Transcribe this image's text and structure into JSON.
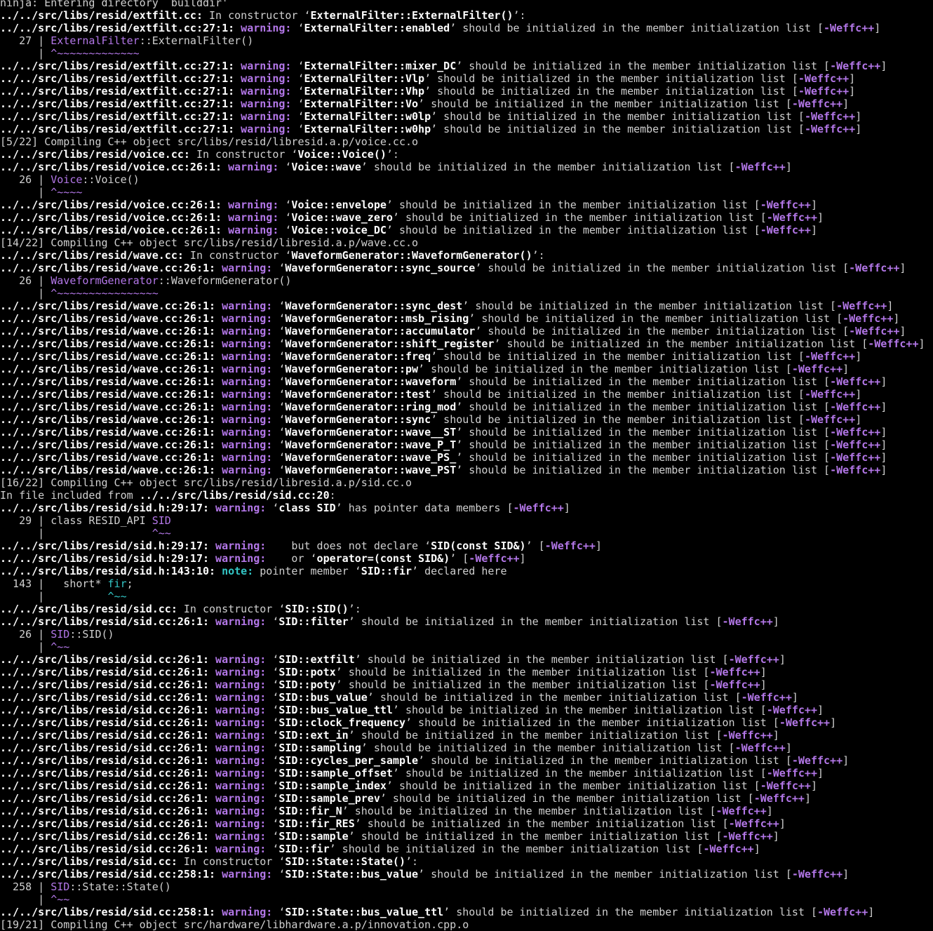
{
  "terminal": {
    "lines": [
      {
        "t": "raw",
        "text": "ninja: Entering directory `builddir'"
      },
      {
        "t": "loc",
        "loc": "../../src/libs/resid/extfilt.cc:",
        "msg": " In constructor ‘",
        "q": "ExternalFilter::ExternalFilter()",
        "end": "’:"
      },
      {
        "t": "warn",
        "loc": "../../src/libs/resid/extfilt.cc:27:1:",
        "kind": "warning:",
        "pre": "",
        "sym": "ExternalFilter::enabled",
        "post": " should be initialized in the member initialization list [",
        "flag": "-Weffc++",
        "tail": "]"
      },
      {
        "t": "code",
        "gutter": "   27 | ",
        "hl": "ExternalFilter",
        "rest": "::ExternalFilter()"
      },
      {
        "t": "caret",
        "gutter": "      | ",
        "caret": "^~~~~~~~~~~~~~"
      },
      {
        "t": "warn",
        "loc": "../../src/libs/resid/extfilt.cc:27:1:",
        "kind": "warning:",
        "pre": "",
        "sym": "ExternalFilter::mixer_DC",
        "post": " should be initialized in the member initialization list [",
        "flag": "-Weffc++",
        "tail": "]"
      },
      {
        "t": "warn",
        "loc": "../../src/libs/resid/extfilt.cc:27:1:",
        "kind": "warning:",
        "pre": "",
        "sym": "ExternalFilter::Vlp",
        "post": " should be initialized in the member initialization list [",
        "flag": "-Weffc++",
        "tail": "]"
      },
      {
        "t": "warn",
        "loc": "../../src/libs/resid/extfilt.cc:27:1:",
        "kind": "warning:",
        "pre": "",
        "sym": "ExternalFilter::Vhp",
        "post": " should be initialized in the member initialization list [",
        "flag": "-Weffc++",
        "tail": "]"
      },
      {
        "t": "warn",
        "loc": "../../src/libs/resid/extfilt.cc:27:1:",
        "kind": "warning:",
        "pre": "",
        "sym": "ExternalFilter::Vo",
        "post": " should be initialized in the member initialization list [",
        "flag": "-Weffc++",
        "tail": "]"
      },
      {
        "t": "warn",
        "loc": "../../src/libs/resid/extfilt.cc:27:1:",
        "kind": "warning:",
        "pre": "",
        "sym": "ExternalFilter::w0lp",
        "post": " should be initialized in the member initialization list [",
        "flag": "-Weffc++",
        "tail": "]"
      },
      {
        "t": "warn",
        "loc": "../../src/libs/resid/extfilt.cc:27:1:",
        "kind": "warning:",
        "pre": "",
        "sym": "ExternalFilter::w0hp",
        "post": " should be initialized in the member initialization list [",
        "flag": "-Weffc++",
        "tail": "]"
      },
      {
        "t": "raw",
        "text": "[5/22] Compiling C++ object src/libs/resid/libresid.a.p/voice.cc.o"
      },
      {
        "t": "loc",
        "loc": "../../src/libs/resid/voice.cc:",
        "msg": " In constructor ‘",
        "q": "Voice::Voice()",
        "end": "’:"
      },
      {
        "t": "warn",
        "loc": "../../src/libs/resid/voice.cc:26:1:",
        "kind": "warning:",
        "pre": "",
        "sym": "Voice::wave",
        "post": " should be initialized in the member initialization list [",
        "flag": "-Weffc++",
        "tail": "]"
      },
      {
        "t": "code",
        "gutter": "   26 | ",
        "hl": "Voice",
        "rest": "::Voice()"
      },
      {
        "t": "caret",
        "gutter": "      | ",
        "caret": "^~~~~"
      },
      {
        "t": "warn",
        "loc": "../../src/libs/resid/voice.cc:26:1:",
        "kind": "warning:",
        "pre": "",
        "sym": "Voice::envelope",
        "post": " should be initialized in the member initialization list [",
        "flag": "-Weffc++",
        "tail": "]"
      },
      {
        "t": "warn",
        "loc": "../../src/libs/resid/voice.cc:26:1:",
        "kind": "warning:",
        "pre": "",
        "sym": "Voice::wave_zero",
        "post": " should be initialized in the member initialization list [",
        "flag": "-Weffc++",
        "tail": "]"
      },
      {
        "t": "warn",
        "loc": "../../src/libs/resid/voice.cc:26:1:",
        "kind": "warning:",
        "pre": "",
        "sym": "Voice::voice_DC",
        "post": " should be initialized in the member initialization list [",
        "flag": "-Weffc++",
        "tail": "]"
      },
      {
        "t": "raw",
        "text": "[14/22] Compiling C++ object src/libs/resid/libresid.a.p/wave.cc.o"
      },
      {
        "t": "loc",
        "loc": "../../src/libs/resid/wave.cc:",
        "msg": " In constructor ‘",
        "q": "WaveformGenerator::WaveformGenerator()",
        "end": "’:"
      },
      {
        "t": "warn",
        "loc": "../../src/libs/resid/wave.cc:26:1:",
        "kind": "warning:",
        "pre": "",
        "sym": "WaveformGenerator::sync_source",
        "post": " should be initialized in the member initialization list [",
        "flag": "-Weffc++",
        "tail": "]"
      },
      {
        "t": "code",
        "gutter": "   26 | ",
        "hl": "WaveformGenerator",
        "rest": "::WaveformGenerator()"
      },
      {
        "t": "caret",
        "gutter": "      | ",
        "caret": "^~~~~~~~~~~~~~~~~"
      },
      {
        "t": "warn",
        "loc": "../../src/libs/resid/wave.cc:26:1:",
        "kind": "warning:",
        "pre": "",
        "sym": "WaveformGenerator::sync_dest",
        "post": " should be initialized in the member initialization list [",
        "flag": "-Weffc++",
        "tail": "]"
      },
      {
        "t": "warn",
        "loc": "../../src/libs/resid/wave.cc:26:1:",
        "kind": "warning:",
        "pre": "",
        "sym": "WaveformGenerator::msb_rising",
        "post": " should be initialized in the member initialization list [",
        "flag": "-Weffc++",
        "tail": "]"
      },
      {
        "t": "warn",
        "loc": "../../src/libs/resid/wave.cc:26:1:",
        "kind": "warning:",
        "pre": "",
        "sym": "WaveformGenerator::accumulator",
        "post": " should be initialized in the member initialization list [",
        "flag": "-Weffc++",
        "tail": "]"
      },
      {
        "t": "warn",
        "loc": "../../src/libs/resid/wave.cc:26:1:",
        "kind": "warning:",
        "pre": "",
        "sym": "WaveformGenerator::shift_register",
        "post": " should be initialized in the member initialization list [",
        "flag": "-Weffc++",
        "tail": "]"
      },
      {
        "t": "warn",
        "loc": "../../src/libs/resid/wave.cc:26:1:",
        "kind": "warning:",
        "pre": "",
        "sym": "WaveformGenerator::freq",
        "post": " should be initialized in the member initialization list [",
        "flag": "-Weffc++",
        "tail": "]"
      },
      {
        "t": "warn",
        "loc": "../../src/libs/resid/wave.cc:26:1:",
        "kind": "warning:",
        "pre": "",
        "sym": "WaveformGenerator::pw",
        "post": " should be initialized in the member initialization list [",
        "flag": "-Weffc++",
        "tail": "]"
      },
      {
        "t": "warn",
        "loc": "../../src/libs/resid/wave.cc:26:1:",
        "kind": "warning:",
        "pre": "",
        "sym": "WaveformGenerator::waveform",
        "post": " should be initialized in the member initialization list [",
        "flag": "-Weffc++",
        "tail": "]"
      },
      {
        "t": "warn",
        "loc": "../../src/libs/resid/wave.cc:26:1:",
        "kind": "warning:",
        "pre": "",
        "sym": "WaveformGenerator::test",
        "post": " should be initialized in the member initialization list [",
        "flag": "-Weffc++",
        "tail": "]"
      },
      {
        "t": "warn",
        "loc": "../../src/libs/resid/wave.cc:26:1:",
        "kind": "warning:",
        "pre": "",
        "sym": "WaveformGenerator::ring_mod",
        "post": " should be initialized in the member initialization list [",
        "flag": "-Weffc++",
        "tail": "]"
      },
      {
        "t": "warn",
        "loc": "../../src/libs/resid/wave.cc:26:1:",
        "kind": "warning:",
        "pre": "",
        "sym": "WaveformGenerator::sync",
        "post": " should be initialized in the member initialization list [",
        "flag": "-Weffc++",
        "tail": "]"
      },
      {
        "t": "warn",
        "loc": "../../src/libs/resid/wave.cc:26:1:",
        "kind": "warning:",
        "pre": "",
        "sym": "WaveformGenerator::wave__ST",
        "post": " should be initialized in the member initialization list [",
        "flag": "-Weffc++",
        "tail": "]"
      },
      {
        "t": "warn",
        "loc": "../../src/libs/resid/wave.cc:26:1:",
        "kind": "warning:",
        "pre": "",
        "sym": "WaveformGenerator::wave_P_T",
        "post": " should be initialized in the member initialization list [",
        "flag": "-Weffc++",
        "tail": "]"
      },
      {
        "t": "warn",
        "loc": "../../src/libs/resid/wave.cc:26:1:",
        "kind": "warning:",
        "pre": "",
        "sym": "WaveformGenerator::wave_PS_",
        "post": " should be initialized in the member initialization list [",
        "flag": "-Weffc++",
        "tail": "]"
      },
      {
        "t": "warn",
        "loc": "../../src/libs/resid/wave.cc:26:1:",
        "kind": "warning:",
        "pre": "",
        "sym": "WaveformGenerator::wave_PST",
        "post": " should be initialized in the member initialization list [",
        "flag": "-Weffc++",
        "tail": "]"
      },
      {
        "t": "raw",
        "text": "[16/22] Compiling C++ object src/libs/resid/libresid.a.p/sid.cc.o"
      },
      {
        "t": "incl",
        "pre": "In file included from ",
        "loc": "../../src/libs/resid/sid.cc:20",
        "end": ":"
      },
      {
        "t": "warn",
        "loc": "../../src/libs/resid/sid.h:29:17:",
        "kind": "warning:",
        "pre": "",
        "sym": "class SID",
        "post": " has pointer data members [",
        "flag": "-Weffc++",
        "tail": "]"
      },
      {
        "t": "code",
        "gutter": "   29 | ",
        "pre": "class RESID_API ",
        "hl": "SID",
        "rest": ""
      },
      {
        "t": "caret",
        "gutter": "      | ",
        "pad": "                ",
        "caret": "^~~"
      },
      {
        "t": "warn",
        "loc": "../../src/libs/resid/sid.h:29:17:",
        "kind": "warning:",
        "pre": "   but does not declare ",
        "sym": "SID(const SID&)",
        "post": " [",
        "flag": "-Weffc++",
        "tail": "]"
      },
      {
        "t": "warn",
        "loc": "../../src/libs/resid/sid.h:29:17:",
        "kind": "warning:",
        "pre": "   or ",
        "sym": "operator=(const SID&)",
        "post": " [",
        "flag": "-Weffc++",
        "tail": "]"
      },
      {
        "t": "note",
        "loc": "../../src/libs/resid/sid.h:143:10:",
        "kind": "note:",
        "pre": " pointer member ",
        "sym": "SID::fir",
        "post": " declared here"
      },
      {
        "t": "code",
        "gutter": "  143 | ",
        "pre": "  short* ",
        "hl": "fir",
        "rest": ";",
        "note": true
      },
      {
        "t": "caret",
        "gutter": "      | ",
        "pad": "         ",
        "caret": "^~~",
        "note": true
      },
      {
        "t": "loc",
        "loc": "../../src/libs/resid/sid.cc:",
        "msg": " In constructor ‘",
        "q": "SID::SID()",
        "end": "’:"
      },
      {
        "t": "warn",
        "loc": "../../src/libs/resid/sid.cc:26:1:",
        "kind": "warning:",
        "pre": "",
        "sym": "SID::filter",
        "post": " should be initialized in the member initialization list [",
        "flag": "-Weffc++",
        "tail": "]"
      },
      {
        "t": "code",
        "gutter": "   26 | ",
        "hl": "SID",
        "rest": "::SID()"
      },
      {
        "t": "caret",
        "gutter": "      | ",
        "caret": "^~~"
      },
      {
        "t": "warn",
        "loc": "../../src/libs/resid/sid.cc:26:1:",
        "kind": "warning:",
        "pre": "",
        "sym": "SID::extfilt",
        "post": " should be initialized in the member initialization list [",
        "flag": "-Weffc++",
        "tail": "]"
      },
      {
        "t": "warn",
        "loc": "../../src/libs/resid/sid.cc:26:1:",
        "kind": "warning:",
        "pre": "",
        "sym": "SID::potx",
        "post": " should be initialized in the member initialization list [",
        "flag": "-Weffc++",
        "tail": "]"
      },
      {
        "t": "warn",
        "loc": "../../src/libs/resid/sid.cc:26:1:",
        "kind": "warning:",
        "pre": "",
        "sym": "SID::poty",
        "post": " should be initialized in the member initialization list [",
        "flag": "-Weffc++",
        "tail": "]"
      },
      {
        "t": "warn",
        "loc": "../../src/libs/resid/sid.cc:26:1:",
        "kind": "warning:",
        "pre": "",
        "sym": "SID::bus_value",
        "post": " should be initialized in the member initialization list [",
        "flag": "-Weffc++",
        "tail": "]"
      },
      {
        "t": "warn",
        "loc": "../../src/libs/resid/sid.cc:26:1:",
        "kind": "warning:",
        "pre": "",
        "sym": "SID::bus_value_ttl",
        "post": " should be initialized in the member initialization list [",
        "flag": "-Weffc++",
        "tail": "]"
      },
      {
        "t": "warn",
        "loc": "../../src/libs/resid/sid.cc:26:1:",
        "kind": "warning:",
        "pre": "",
        "sym": "SID::clock_frequency",
        "post": " should be initialized in the member initialization list [",
        "flag": "-Weffc++",
        "tail": "]"
      },
      {
        "t": "warn",
        "loc": "../../src/libs/resid/sid.cc:26:1:",
        "kind": "warning:",
        "pre": "",
        "sym": "SID::ext_in",
        "post": " should be initialized in the member initialization list [",
        "flag": "-Weffc++",
        "tail": "]"
      },
      {
        "t": "warn",
        "loc": "../../src/libs/resid/sid.cc:26:1:",
        "kind": "warning:",
        "pre": "",
        "sym": "SID::sampling",
        "post": " should be initialized in the member initialization list [",
        "flag": "-Weffc++",
        "tail": "]"
      },
      {
        "t": "warn",
        "loc": "../../src/libs/resid/sid.cc:26:1:",
        "kind": "warning:",
        "pre": "",
        "sym": "SID::cycles_per_sample",
        "post": " should be initialized in the member initialization list [",
        "flag": "-Weffc++",
        "tail": "]"
      },
      {
        "t": "warn",
        "loc": "../../src/libs/resid/sid.cc:26:1:",
        "kind": "warning:",
        "pre": "",
        "sym": "SID::sample_offset",
        "post": " should be initialized in the member initialization list [",
        "flag": "-Weffc++",
        "tail": "]"
      },
      {
        "t": "warn",
        "loc": "../../src/libs/resid/sid.cc:26:1:",
        "kind": "warning:",
        "pre": "",
        "sym": "SID::sample_index",
        "post": " should be initialized in the member initialization list [",
        "flag": "-Weffc++",
        "tail": "]"
      },
      {
        "t": "warn",
        "loc": "../../src/libs/resid/sid.cc:26:1:",
        "kind": "warning:",
        "pre": "",
        "sym": "SID::sample_prev",
        "post": " should be initialized in the member initialization list [",
        "flag": "-Weffc++",
        "tail": "]"
      },
      {
        "t": "warn",
        "loc": "../../src/libs/resid/sid.cc:26:1:",
        "kind": "warning:",
        "pre": "",
        "sym": "SID::fir_N",
        "post": " should be initialized in the member initialization list [",
        "flag": "-Weffc++",
        "tail": "]"
      },
      {
        "t": "warn",
        "loc": "../../src/libs/resid/sid.cc:26:1:",
        "kind": "warning:",
        "pre": "",
        "sym": "SID::fir_RES",
        "post": " should be initialized in the member initialization list [",
        "flag": "-Weffc++",
        "tail": "]"
      },
      {
        "t": "warn",
        "loc": "../../src/libs/resid/sid.cc:26:1:",
        "kind": "warning:",
        "pre": "",
        "sym": "SID::sample",
        "post": " should be initialized in the member initialization list [",
        "flag": "-Weffc++",
        "tail": "]"
      },
      {
        "t": "warn",
        "loc": "../../src/libs/resid/sid.cc:26:1:",
        "kind": "warning:",
        "pre": "",
        "sym": "SID::fir",
        "post": " should be initialized in the member initialization list [",
        "flag": "-Weffc++",
        "tail": "]"
      },
      {
        "t": "loc",
        "loc": "../../src/libs/resid/sid.cc:",
        "msg": " In constructor ‘",
        "q": "SID::State::State()",
        "end": "’:"
      },
      {
        "t": "warn",
        "loc": "../../src/libs/resid/sid.cc:258:1:",
        "kind": "warning:",
        "pre": "",
        "sym": "SID::State::bus_value",
        "post": " should be initialized in the member initialization list [",
        "flag": "-Weffc++",
        "tail": "]"
      },
      {
        "t": "code",
        "gutter": "  258 | ",
        "hl": "SID",
        "rest": "::State::State()"
      },
      {
        "t": "caret",
        "gutter": "      | ",
        "caret": "^~~"
      },
      {
        "t": "warn",
        "loc": "../../src/libs/resid/sid.cc:258:1:",
        "kind": "warning:",
        "pre": "",
        "sym": "SID::State::bus_value_ttl",
        "post": " should be initialized in the member initialization list [",
        "flag": "-Weffc++",
        "tail": "]"
      },
      {
        "t": "raw",
        "text": "[19/21] Compiling C++ object src/hardware/libhardware.a.p/innovation.cpp.o"
      }
    ]
  },
  "colors": {
    "background": "#000000",
    "text": "#d0d0d0",
    "bold": "#ffffff",
    "warning": "#b377e8",
    "note": "#33c6c6"
  }
}
